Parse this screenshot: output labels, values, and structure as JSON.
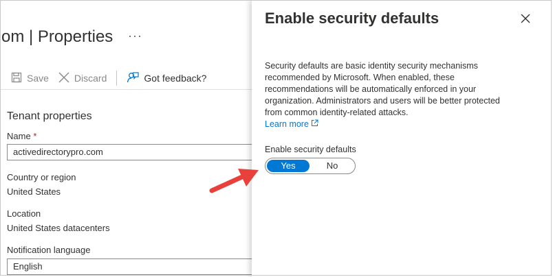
{
  "left_blade": {
    "title_prefix": "om",
    "title_separator": "|",
    "title_suffix": "Properties",
    "more_label": "···",
    "toolbar": {
      "save_label": "Save",
      "discard_label": "Discard",
      "feedback_label": "Got feedback?"
    },
    "section_title": "Tenant properties",
    "name_label": "Name",
    "name_required": "*",
    "name_value": "activedirectorypro.com",
    "country_label": "Country or region",
    "country_value": "United States",
    "location_label": "Location",
    "location_value": "United States datacenters",
    "notification_label": "Notification language",
    "notification_value": "English"
  },
  "panel": {
    "title": "Enable security defaults",
    "description": "Security defaults are basic identity security mechanisms recommended by Microsoft. When enabled, these recommendations will be automatically enforced in your organization. Administrators and users will be better protected from common identity-related attacks.",
    "learn_more_label": "Learn more",
    "toggle_label": "Enable security defaults",
    "toggle_options": [
      "Yes",
      "No"
    ],
    "toggle_selected": "Yes"
  },
  "colors": {
    "accent": "#0078d4",
    "arrow": "#e8413b",
    "required": "#a4262c",
    "text": "#323130",
    "muted": "#8a8886"
  },
  "icons": [
    "save-icon",
    "discard-icon",
    "feedback-icon",
    "close-icon",
    "external-link-icon"
  ]
}
